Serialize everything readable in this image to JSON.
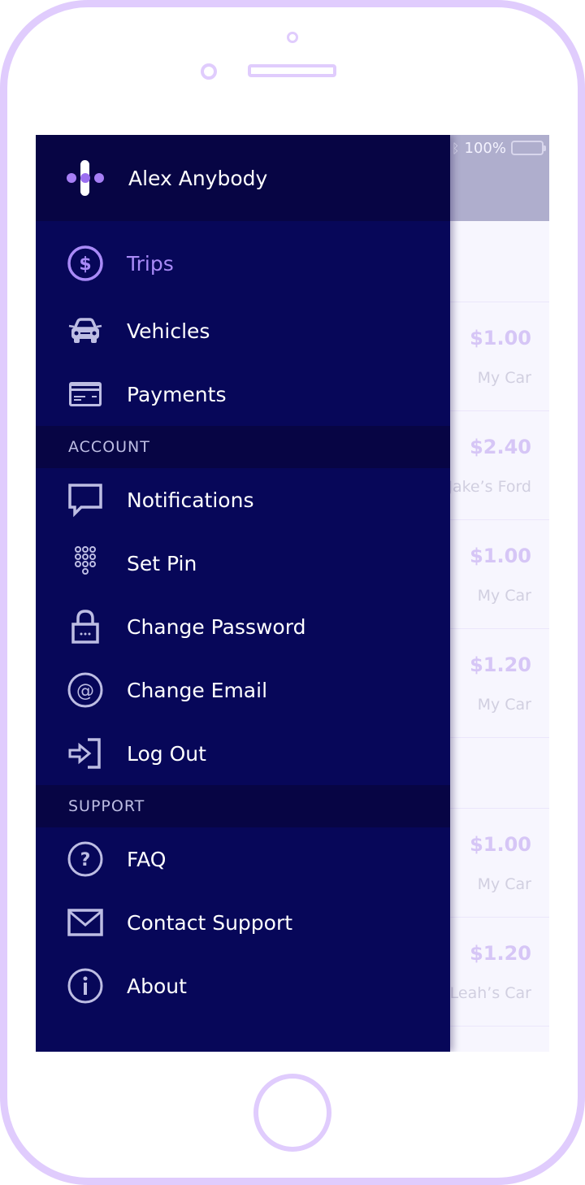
{
  "status_bar": {
    "battery_percent": "100%",
    "bluetooth_icon": "bluetooth-icon",
    "battery_icon": "battery-icon"
  },
  "drawer": {
    "user_name": "Alex Anybody",
    "logo_icon": "app-logo-icon",
    "main_items": [
      {
        "label": "Trips",
        "icon": "dollar-circle-icon",
        "active": true
      },
      {
        "label": "Vehicles",
        "icon": "car-icon",
        "active": false
      },
      {
        "label": "Payments",
        "icon": "credit-card-icon",
        "active": false
      }
    ],
    "account_section": {
      "title": "ACCOUNT",
      "items": [
        {
          "label": "Notifications",
          "icon": "speech-bubble-icon"
        },
        {
          "label": "Set Pin",
          "icon": "keypad-icon"
        },
        {
          "label": "Change Password",
          "icon": "lock-icon"
        },
        {
          "label": "Change Email",
          "icon": "at-sign-icon"
        },
        {
          "label": "Log Out",
          "icon": "logout-icon"
        }
      ]
    },
    "support_section": {
      "title": "SUPPORT",
      "items": [
        {
          "label": "FAQ",
          "icon": "question-circle-icon"
        },
        {
          "label": "Contact Support",
          "icon": "envelope-icon"
        },
        {
          "label": "About",
          "icon": "info-circle-icon"
        }
      ]
    }
  },
  "trips": [
    {
      "amount": "$1.00",
      "vehicle": "My Car"
    },
    {
      "amount": "$2.40",
      "vehicle": "Jake’s Ford"
    },
    {
      "amount": "$1.00",
      "vehicle": "My Car"
    },
    {
      "amount": "$1.20",
      "vehicle": "My Car"
    },
    {
      "amount": "$1.00",
      "vehicle": "My Car"
    },
    {
      "amount": "$1.20",
      "vehicle": "Leah’s Car"
    }
  ],
  "colors": {
    "drawer_bg": "#070759",
    "drawer_header_bg": "#070544",
    "accent": "#a98af7",
    "icon": "#bdbde3",
    "frame": "#e0ccfd"
  }
}
